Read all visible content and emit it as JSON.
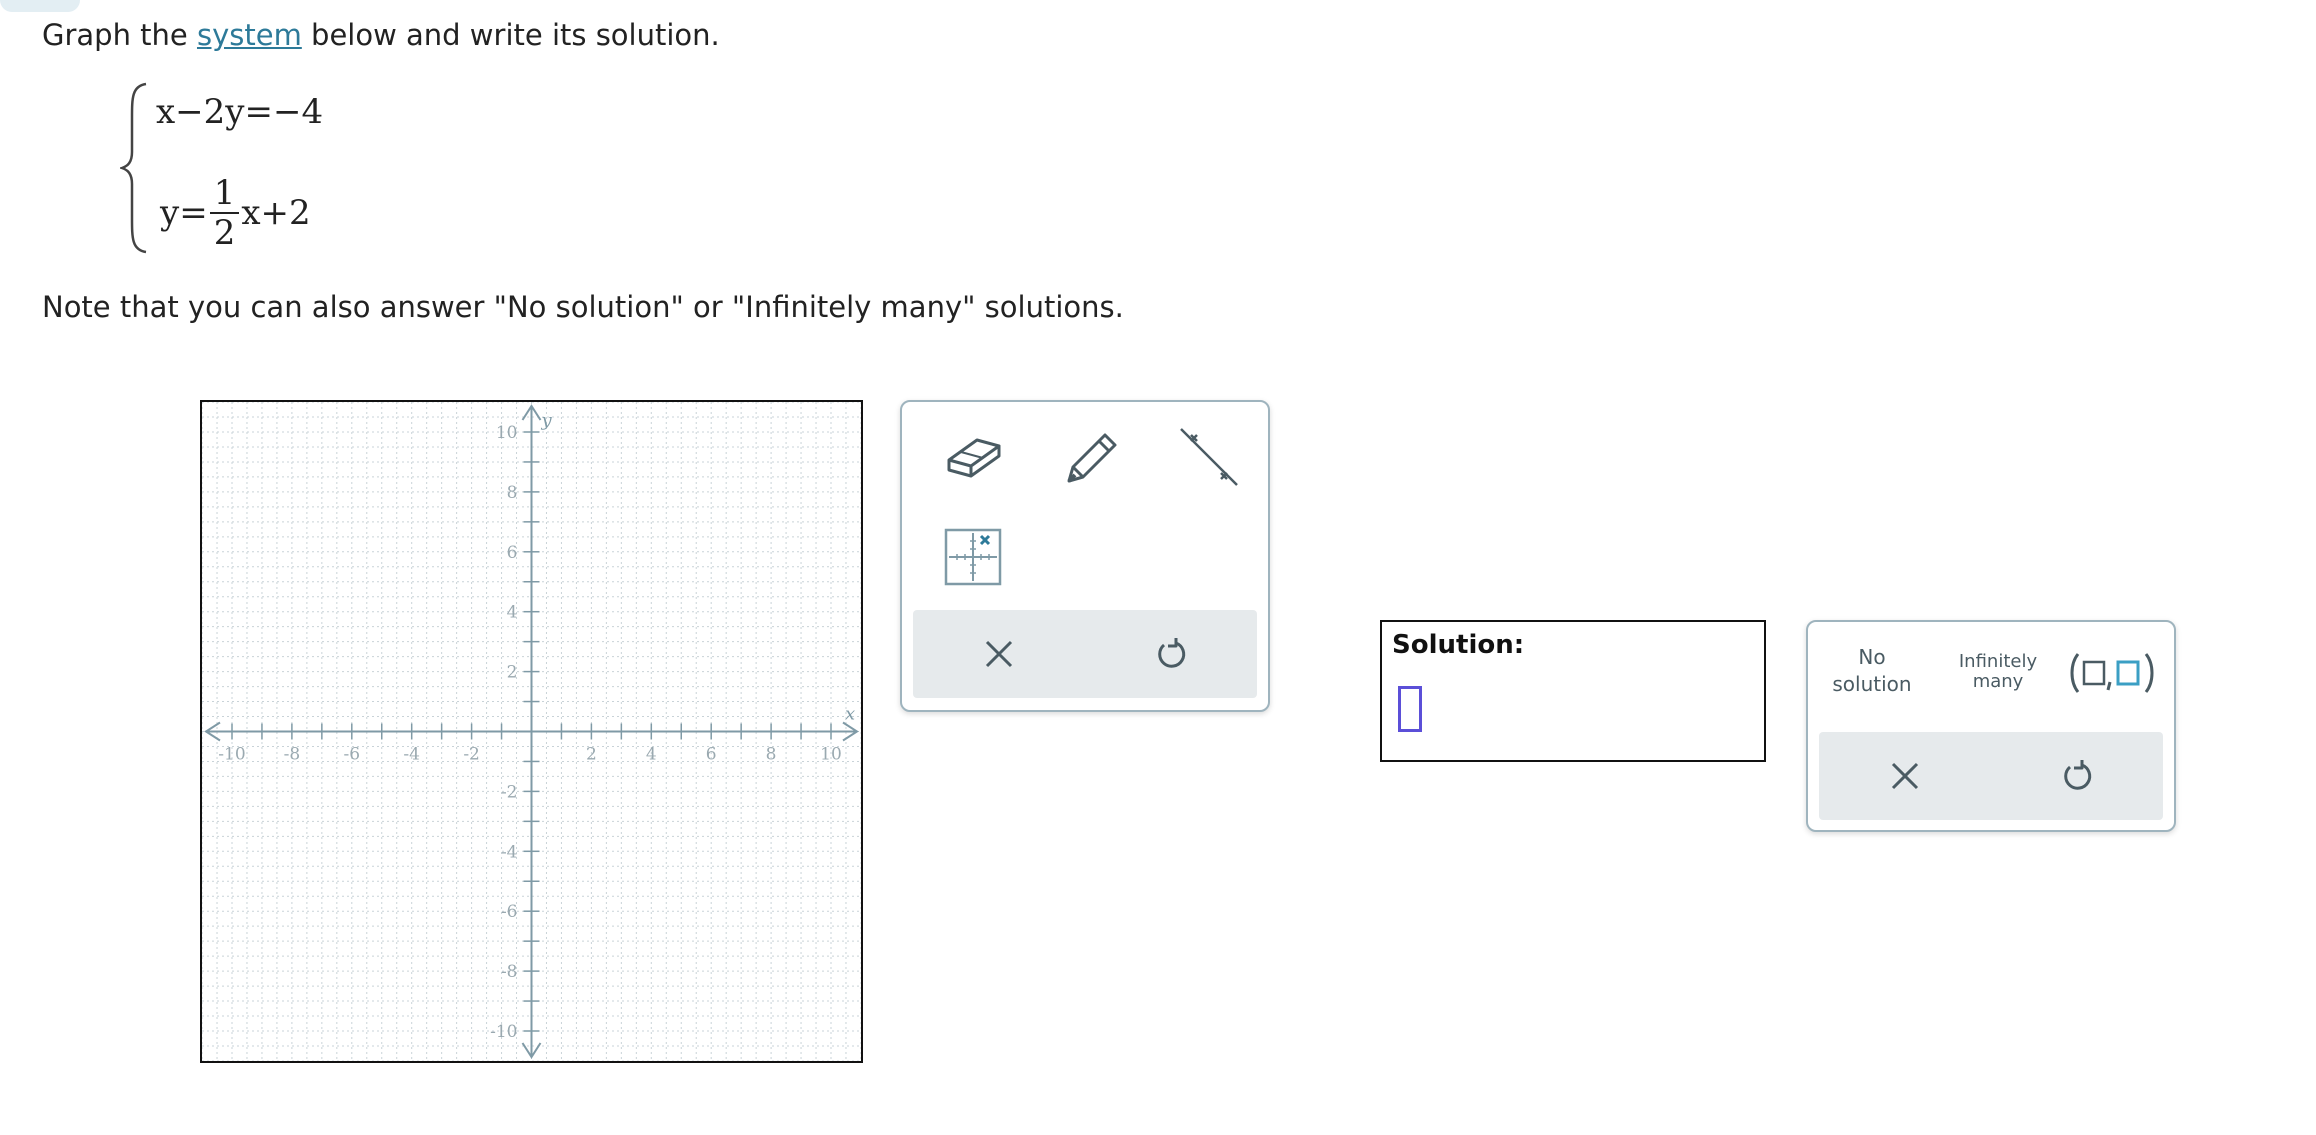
{
  "prompt": {
    "before_link": "Graph the ",
    "link_text": "system",
    "after_link": " below and write its solution."
  },
  "system": {
    "eq1": "x−2y=−4",
    "eq2_lhs": "y=",
    "eq2_frac_num": "1",
    "eq2_frac_den": "2",
    "eq2_rhs": "x+2"
  },
  "note": "Note that you can also answer \"No solution\" or \"Infinitely many\" solutions.",
  "graph": {
    "x_label": "x",
    "y_label": "y",
    "x_ticks": [
      "-10",
      "-8",
      "-6",
      "-4",
      "-2",
      "2",
      "4",
      "6",
      "8",
      "10"
    ],
    "y_ticks": [
      "10",
      "8",
      "6",
      "4",
      "2",
      "-2",
      "-4",
      "-6",
      "-8",
      "-10"
    ],
    "xlim": [
      -10,
      10
    ],
    "ylim": [
      -10,
      10
    ],
    "grid": true
  },
  "tools": {
    "eraser": "eraser-icon",
    "pencil": "pencil-icon",
    "line": "line-tool-icon",
    "point_grid": "point-grid-icon",
    "clear": "close-icon",
    "undo": "undo-icon"
  },
  "solution": {
    "label": "Solution:"
  },
  "answer_options": {
    "no_solution_line1": "No",
    "no_solution_line2": "solution",
    "infinitely_line1": "Infinitely",
    "infinitely_line2": "many",
    "pair_icon": "ordered-pair-icon"
  },
  "colors": {
    "link": "#2d7a99",
    "axis": "#7f9aa6",
    "tool_icon": "#4a5b63",
    "answer_slot": "#5b4fd8",
    "pair_accent": "#3b9fc4"
  }
}
